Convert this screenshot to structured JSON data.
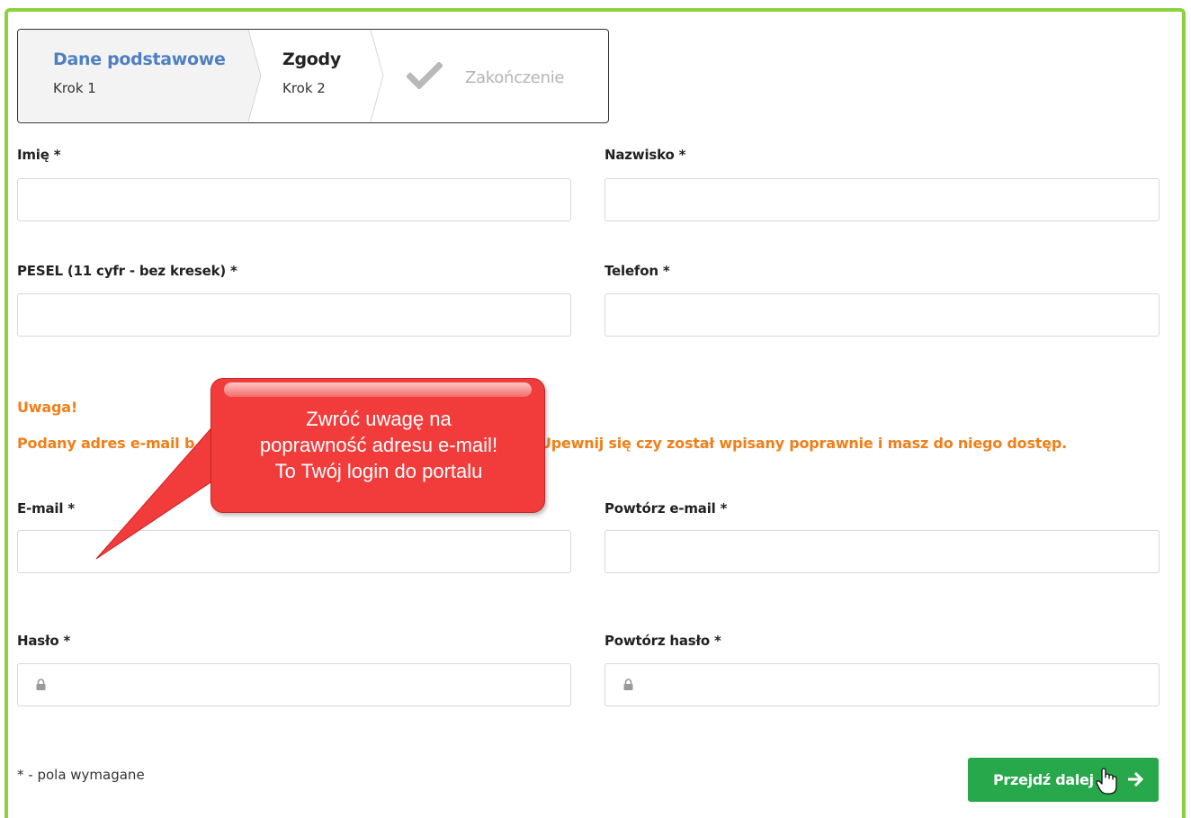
{
  "wizard": {
    "steps": [
      {
        "title": "Dane podstawowe",
        "sub": "Krok 1"
      },
      {
        "title": "Zgody",
        "sub": "Krok 2"
      },
      {
        "title": "Zakończenie"
      }
    ],
    "active_color": "#4f7fc1"
  },
  "form": {
    "first_name": {
      "label": "Imię *",
      "value": ""
    },
    "last_name": {
      "label": "Nazwisko *",
      "value": ""
    },
    "pesel": {
      "label": "PESEL (11 cyfr - bez kresek) *",
      "value": ""
    },
    "phone": {
      "label": "Telefon *",
      "value": ""
    },
    "email": {
      "label": "E-mail *",
      "value": ""
    },
    "email_repeat": {
      "label": "Powtórz e-mail *",
      "value": ""
    },
    "password": {
      "label": "Hasło *",
      "icon": "lock-icon"
    },
    "password_repeat": {
      "label": "Powtórz hasło *",
      "icon": "lock-icon"
    }
  },
  "warning": {
    "title": "Uwaga!",
    "text_left": "Podany adres e-mail b",
    "text_right": "Upewnij się czy został wpisany poprawnie i masz do niego dostęp.",
    "color": "#f07f1a"
  },
  "callout": {
    "lines": [
      "Zwróć uwagę na",
      "poprawność adresu e-mail!",
      "To Twój login do portalu"
    ],
    "color": "#f23c3c"
  },
  "footer": {
    "required_note": "* - pola wymagane",
    "next_button": "Przejdź dalej",
    "button_color": "#27a84a"
  },
  "frame_color": "#8cd23c"
}
